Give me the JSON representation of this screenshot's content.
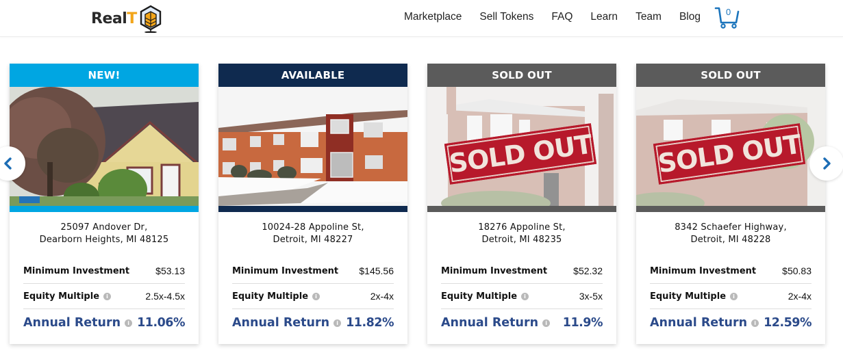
{
  "header": {
    "logo_text_main": "Real",
    "logo_text_accent": "T",
    "nav": [
      "Marketplace",
      "Sell Tokens",
      "FAQ",
      "Learn",
      "Team",
      "Blog"
    ],
    "cart_count": "0"
  },
  "colors": {
    "new": "#00a6e2",
    "available": "#0f2a4f",
    "sold_out": "#5b5b5b",
    "accent_text": "#2b4a8a",
    "cart_blue": "#1c75bc",
    "logo_orange": "#f2a51a"
  },
  "labels": {
    "min_investment": "Minimum Investment",
    "equity_multiple": "Equity Multiple",
    "annual_return": "Annual Return",
    "info_glyph": "i",
    "stamp_text": "SOLD OUT"
  },
  "cards": [
    {
      "badge": "NEW!",
      "status": "new",
      "image": "house-photo-yellow-siding",
      "address_line1": "25097 Andover Dr,",
      "address_line2": "Dearborn Heights, MI 48125",
      "min_investment": "$53.13",
      "equity_multiple": "2.5x-4.5x",
      "annual_return": "11.06%"
    },
    {
      "badge": "AVAILABLE",
      "status": "available",
      "image": "apartment-photo-brick-snow",
      "address_line1": "10024-28 Appoline St,",
      "address_line2": "Detroit, MI 48227",
      "min_investment": "$145.56",
      "equity_multiple": "2x-4x",
      "annual_return": "11.82%"
    },
    {
      "badge": "SOLD OUT",
      "status": "sold_out",
      "image": "house-photo-brick-sold-out-stamp",
      "address_line1": "18276 Appoline St,",
      "address_line2": "Detroit, MI 48235",
      "min_investment": "$52.32",
      "equity_multiple": "3x-5x",
      "annual_return": "11.9%"
    },
    {
      "badge": "SOLD OUT",
      "status": "sold_out",
      "image": "house-photo-brick-sold-out-stamp",
      "address_line1": "8342 Schaefer Highway,",
      "address_line2": "Detroit, MI 48228",
      "min_investment": "$50.83",
      "equity_multiple": "2x-4x",
      "annual_return": "12.59%"
    }
  ],
  "carousel": {
    "prev_icon": "chevron-left-icon",
    "next_icon": "chevron-right-icon"
  }
}
